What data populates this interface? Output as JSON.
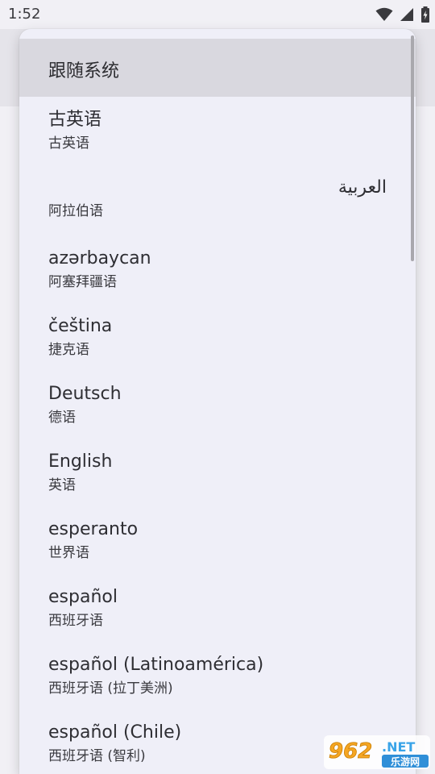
{
  "status_bar": {
    "time": "1:52",
    "icons": [
      "wifi-icon",
      "cellular-signal-icon",
      "battery-charging-icon"
    ]
  },
  "menu": {
    "selected": "跟随系统",
    "items": [
      {
        "primary": "古英语",
        "secondary": "古英语"
      },
      {
        "primary": "العربية",
        "secondary": "阿拉伯语",
        "rtl": true
      },
      {
        "primary": "azərbaycan",
        "secondary": "阿塞拜疆语"
      },
      {
        "primary": "čeština",
        "secondary": "捷克语"
      },
      {
        "primary": "Deutsch",
        "secondary": "德语"
      },
      {
        "primary": "English",
        "secondary": "英语"
      },
      {
        "primary": "esperanto",
        "secondary": "世界语"
      },
      {
        "primary": "español",
        "secondary": "西班牙语"
      },
      {
        "primary": "español (Latinoamérica)",
        "secondary": "西班牙语 (拉丁美洲)"
      },
      {
        "primary": "español (Chile)",
        "secondary": "西班牙语 (智利)"
      }
    ]
  },
  "watermark": {
    "number": "962",
    "suffix": ".NET",
    "chinese": "乐游网"
  },
  "colors": {
    "menu_background": "#efeff8",
    "selected_background": "#d9d8df",
    "text_primary": "#2e2e33",
    "watermark_orange": "#f5a623"
  }
}
